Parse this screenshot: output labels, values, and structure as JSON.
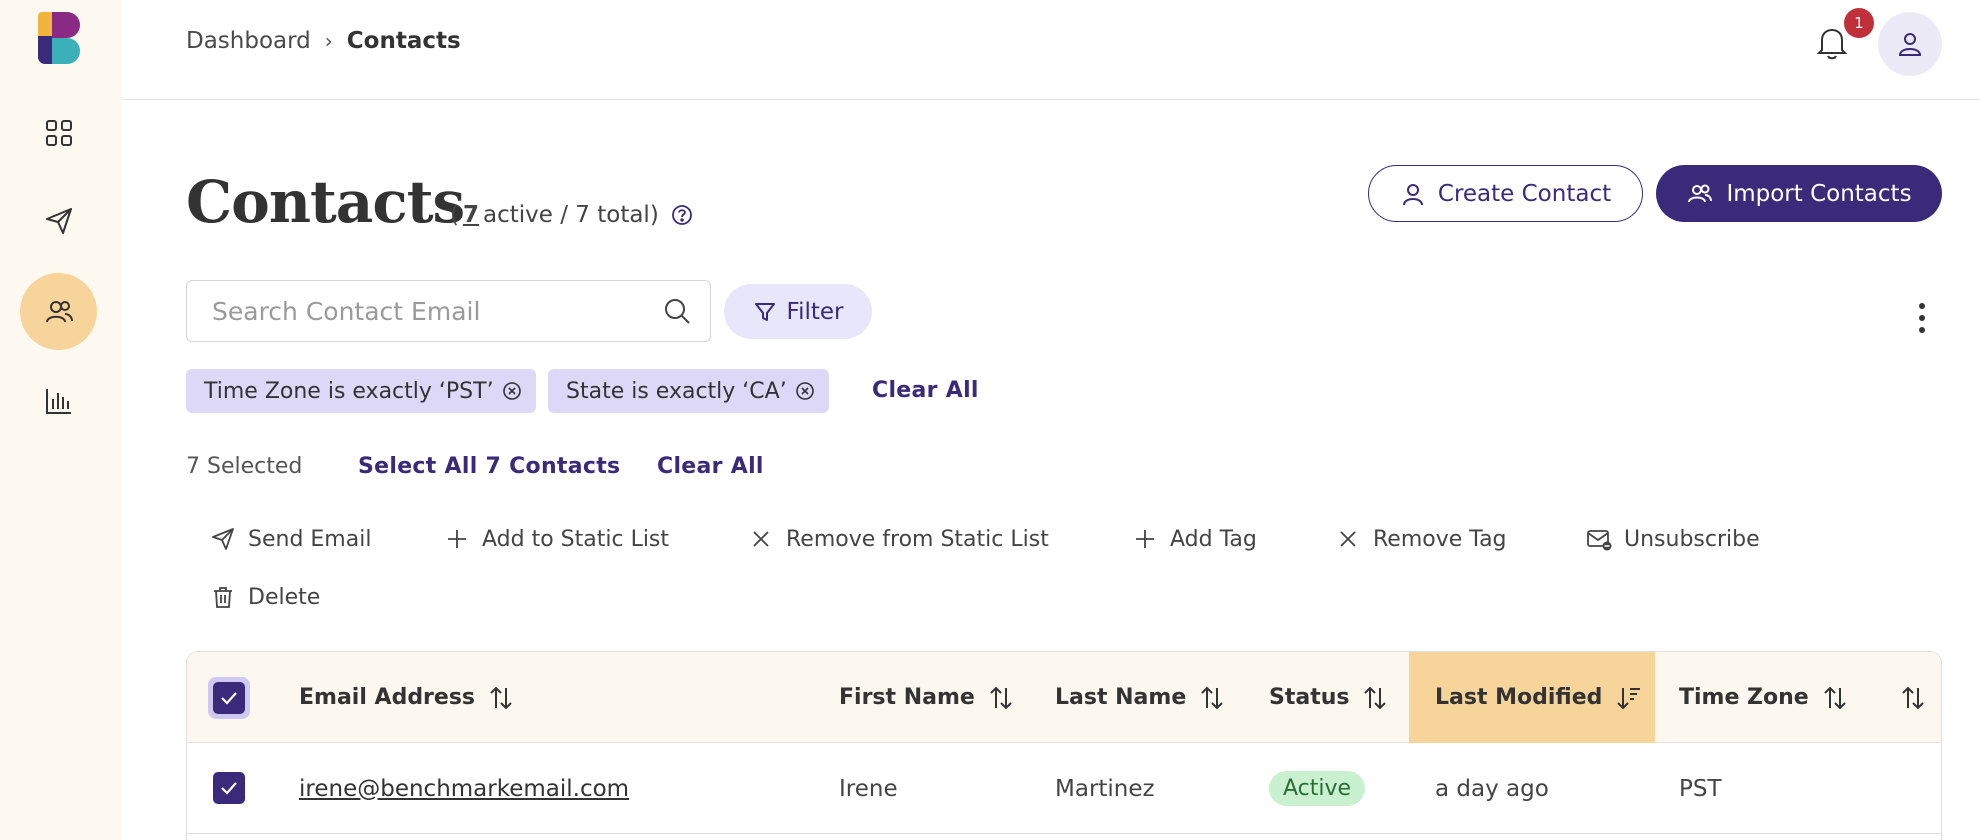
{
  "breadcrumb": {
    "parent": "Dashboard",
    "separator": "›",
    "current": "Contacts"
  },
  "notifications": {
    "count": "1"
  },
  "page": {
    "title": "Contacts",
    "active_count": "7",
    "count_suffix": "active / 7 total)",
    "count_prefix": "("
  },
  "buttons": {
    "create": "Create Contact",
    "import": "Import Contacts",
    "filter": "Filter"
  },
  "search": {
    "placeholder": "Search Contact Email",
    "value": ""
  },
  "filters": [
    {
      "label": "Time Zone is exactly ‘PST’"
    },
    {
      "label": "State is exactly ‘CA’"
    }
  ],
  "filters_clear": "Clear All",
  "selection": {
    "text": "7 Selected",
    "select_all": "Select All 7 Contacts",
    "clear": "Clear All"
  },
  "actions": {
    "send_email": "Send Email",
    "add_static": "Add to Static List",
    "remove_static": "Remove from Static List",
    "add_tag": "Add Tag",
    "remove_tag": "Remove Tag",
    "unsubscribe": "Unsubscribe",
    "delete": "Delete"
  },
  "table": {
    "columns": [
      "Email Address",
      "First Name",
      "Last Name",
      "Status",
      "Last Modified",
      "Time Zone"
    ],
    "rows": [
      {
        "email": "irene@benchmarkemail.com",
        "first": "Irene",
        "last": "Martinez",
        "status": "Active",
        "modified": "a day ago",
        "timezone": "PST"
      }
    ]
  },
  "colors": {
    "primary": "#3a2a7a",
    "accent": "#f7d49a",
    "sidebar_bg": "#fdf8f0",
    "chip_bg": "#ddd8f8"
  }
}
